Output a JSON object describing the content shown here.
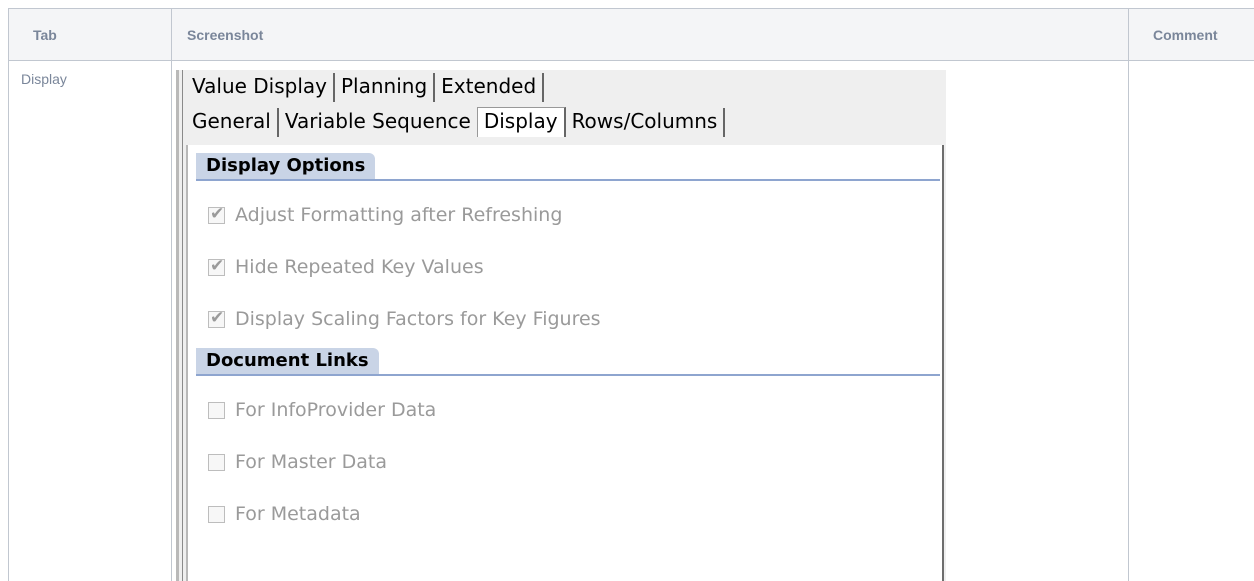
{
  "table": {
    "headers": {
      "tab": "Tab",
      "screenshot": "Screenshot",
      "comment": "Comment"
    },
    "row": {
      "tab": "Display",
      "comment": ""
    }
  },
  "screenshot": {
    "tabs_row1": [
      "Value Display",
      "Planning",
      "Extended"
    ],
    "tabs_row2": [
      "General",
      "Variable Sequence",
      "Display",
      "Rows/Columns"
    ],
    "active_tab": "Display",
    "sections": [
      {
        "title": "Display Options",
        "options": [
          {
            "label": "Adjust Formatting after Refreshing",
            "checked": true
          },
          {
            "label": "Hide Repeated Key Values",
            "checked": true
          },
          {
            "label": "Display Scaling Factors for Key Figures",
            "checked": true
          }
        ]
      },
      {
        "title": "Document Links",
        "options": [
          {
            "label": "For InfoProvider Data",
            "checked": false
          },
          {
            "label": "For Master Data",
            "checked": false
          },
          {
            "label": "For Metadata",
            "checked": false
          }
        ]
      }
    ]
  }
}
